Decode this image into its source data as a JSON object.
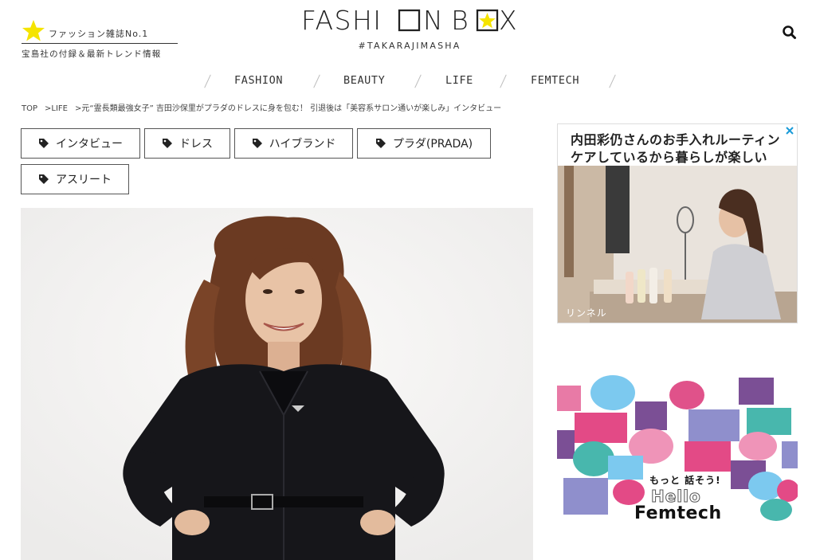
{
  "header": {
    "badge_label": "ファッション雑誌No.1",
    "badge_sub": "宝島社の付録＆最新トレンド情報",
    "logo_text": "FASHION BOX",
    "logo_tag": "#TAKARAJIMASHA",
    "search_icon": "search-icon"
  },
  "nav": {
    "items": [
      "FASHION",
      "BEAUTY",
      "LIFE",
      "FEMTECH"
    ]
  },
  "breadcrumb": {
    "items": [
      "TOP",
      "LIFE",
      "元“霊長類最強女子” 吉田沙保里がプラダのドレスに身を包む！ 引退後は「美容系サロン通いが楽しみ」インタビュー"
    ],
    "separator": ">"
  },
  "tags": [
    "インタビュー",
    "ドレス",
    "ハイブランド",
    "プラダ(PRADA)",
    "アスリート"
  ],
  "ads": {
    "ad1": {
      "line1": "内田彩仍さんのお手入れルーティン",
      "line2": "ケアしているから暮らしが楽しい",
      "brand": "リンネル"
    },
    "ad2": {
      "motto": "もっと 話そう!",
      "hello": "Hello",
      "femtech": "Femtech"
    }
  },
  "colors": {
    "accent_yellow": "#f5e400",
    "text": "#222222",
    "border": "#555555"
  }
}
